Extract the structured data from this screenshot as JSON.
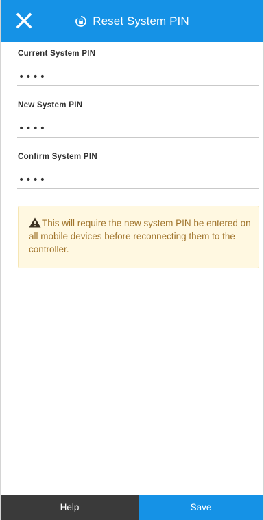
{
  "header": {
    "title": "Reset System PIN",
    "close_icon": "close-icon",
    "title_icon": "lock-reset-icon"
  },
  "fields": [
    {
      "label": "Current System PIN",
      "value": "••••"
    },
    {
      "label": "New System PIN",
      "value": "••••"
    },
    {
      "label": "Confirm System PIN",
      "value": "••••"
    }
  ],
  "warning": {
    "icon": "warning-icon",
    "text": "This will require the new system PIN be entered on all mobile devices before reconnecting them to the controller."
  },
  "footer": {
    "help_label": "Help",
    "save_label": "Save"
  },
  "colors": {
    "primary": "#1592e6",
    "dark": "#3a3a3a",
    "warning_bg": "#fff8e1",
    "warning_text": "#a0742c"
  }
}
